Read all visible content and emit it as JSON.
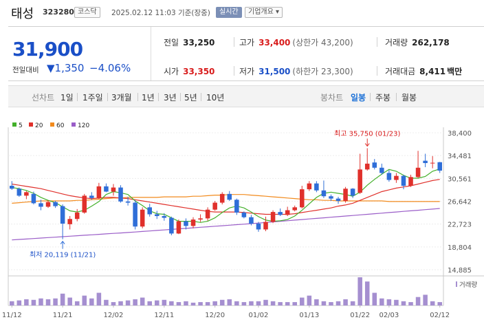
{
  "header": {
    "name": "태성",
    "code": "323280",
    "market": "코스닥",
    "timestamp": "2025.02.12 11:03 기준(장중)",
    "live_label": "실시간",
    "company_label": "기업개요 ▾"
  },
  "quote": {
    "price": "31,900",
    "change_label": "전일대비",
    "change_abs": "▼1,350",
    "change_pct": "−4.06%",
    "prev_close_label": "전일",
    "prev_close": "33,250",
    "high_label": "고가",
    "high": "33,400",
    "upper_limit": "(상한가 43,200)",
    "volume_label": "거래량",
    "volume": "262,178",
    "open_label": "시가",
    "open": "33,350",
    "low_label": "저가",
    "low": "31,500",
    "lower_limit": "(하한가 23,300)",
    "amount_label": "거래대금",
    "amount": "8,411",
    "amount_unit": "백만"
  },
  "periods": {
    "label": "선차트",
    "items": [
      "1일",
      "1주일",
      "3개월",
      "1년",
      "3년",
      "5년",
      "10년"
    ],
    "candle_label": "봉차트",
    "candle_items": [
      "일봉",
      "주봉",
      "월봉"
    ],
    "candle_active": "일봉"
  },
  "colors": {
    "up": "#e0302b",
    "down": "#2f6ed8",
    "ma5": "#43b02a",
    "ma20": "#e0302b",
    "ma60": "#f28a1c",
    "ma120": "#9a5dc8",
    "volume": "#a58fd0",
    "price_blue": "#1a4fc7"
  },
  "chart_data": {
    "type": "candlestick",
    "legend": [
      {
        "name": "5",
        "color": "#43b02a"
      },
      {
        "name": "20",
        "color": "#e0302b"
      },
      {
        "name": "60",
        "color": "#f28a1c"
      },
      {
        "name": "120",
        "color": "#9a5dc8"
      }
    ],
    "y_ticks": [
      "38,400",
      "34,481",
      "30,561",
      "26,642",
      "22,723",
      "18,804",
      "14,885"
    ],
    "ylim": [
      14885,
      38400
    ],
    "x_ticks": [
      "11/12",
      "11/21",
      "12/02",
      "12/11",
      "12/20",
      "01/02",
      "01/13",
      "01/22",
      "02/03",
      "02/12"
    ],
    "high_annotation": "최고 35,750 (01/23)",
    "low_annotation": "최저 20,119 (11/21)",
    "volume_label": "거래량",
    "candles": [
      {
        "d": "11/12",
        "o": 29300,
        "h": 30100,
        "l": 28600,
        "c": 28800
      },
      {
        "d": "11/13",
        "o": 28800,
        "h": 29000,
        "l": 27400,
        "c": 27600
      },
      {
        "d": "11/14",
        "o": 27600,
        "h": 28400,
        "l": 27000,
        "c": 28200
      },
      {
        "d": "11/15",
        "o": 27900,
        "h": 28300,
        "l": 26100,
        "c": 26300
      },
      {
        "d": "11/18",
        "o": 26300,
        "h": 26900,
        "l": 25100,
        "c": 25700
      },
      {
        "d": "11/19",
        "o": 25700,
        "h": 26800,
        "l": 25500,
        "c": 26500
      },
      {
        "d": "11/20",
        "o": 26500,
        "h": 26700,
        "l": 25500,
        "c": 25800
      },
      {
        "d": "11/21",
        "o": 25800,
        "h": 26100,
        "l": 20119,
        "c": 22800
      },
      {
        "d": "11/22",
        "o": 22700,
        "h": 24100,
        "l": 21800,
        "c": 23600
      },
      {
        "d": "11/25",
        "o": 23600,
        "h": 25300,
        "l": 23200,
        "c": 24700
      },
      {
        "d": "11/26",
        "o": 24700,
        "h": 27900,
        "l": 24500,
        "c": 27600
      },
      {
        "d": "11/27",
        "o": 27600,
        "h": 28200,
        "l": 26900,
        "c": 27200
      },
      {
        "d": "11/28",
        "o": 27200,
        "h": 29800,
        "l": 27000,
        "c": 29200
      },
      {
        "d": "11/29",
        "o": 29200,
        "h": 29700,
        "l": 28200,
        "c": 28300
      },
      {
        "d": "12/02",
        "o": 28300,
        "h": 29600,
        "l": 27600,
        "c": 29000
      },
      {
        "d": "12/03",
        "o": 29000,
        "h": 29400,
        "l": 26400,
        "c": 26600
      },
      {
        "d": "12/04",
        "o": 26600,
        "h": 27400,
        "l": 25900,
        "c": 26400
      },
      {
        "d": "12/05",
        "o": 26400,
        "h": 26800,
        "l": 21800,
        "c": 22300
      },
      {
        "d": "12/06",
        "o": 22300,
        "h": 25600,
        "l": 22000,
        "c": 25200
      },
      {
        "d": "12/09",
        "o": 25600,
        "h": 26200,
        "l": 24000,
        "c": 24400
      },
      {
        "d": "12/10",
        "o": 24400,
        "h": 25000,
        "l": 23600,
        "c": 24100
      },
      {
        "d": "12/11",
        "o": 24100,
        "h": 24600,
        "l": 23300,
        "c": 23800
      },
      {
        "d": "12/12",
        "o": 23800,
        "h": 24000,
        "l": 20800,
        "c": 21100
      },
      {
        "d": "12/13",
        "o": 21100,
        "h": 23500,
        "l": 21000,
        "c": 23200
      },
      {
        "d": "12/16",
        "o": 23200,
        "h": 23700,
        "l": 21800,
        "c": 22400
      },
      {
        "d": "12/17",
        "o": 22400,
        "h": 23900,
        "l": 22000,
        "c": 23500
      },
      {
        "d": "12/18",
        "o": 23500,
        "h": 24400,
        "l": 23100,
        "c": 23700
      },
      {
        "d": "12/19",
        "o": 23700,
        "h": 25600,
        "l": 23300,
        "c": 25200
      },
      {
        "d": "12/20",
        "o": 25200,
        "h": 26700,
        "l": 25000,
        "c": 26400
      },
      {
        "d": "12/23",
        "o": 26400,
        "h": 28200,
        "l": 26100,
        "c": 27900
      },
      {
        "d": "12/24",
        "o": 27900,
        "h": 28400,
        "l": 26700,
        "c": 26900
      },
      {
        "d": "12/26",
        "o": 26900,
        "h": 27100,
        "l": 24300,
        "c": 24700
      },
      {
        "d": "12/27",
        "o": 24700,
        "h": 24900,
        "l": 23700,
        "c": 23900
      },
      {
        "d": "12/30",
        "o": 23900,
        "h": 24300,
        "l": 22500,
        "c": 22800
      },
      {
        "d": "01/02",
        "o": 22800,
        "h": 23100,
        "l": 21400,
        "c": 21800
      },
      {
        "d": "01/03",
        "o": 21800,
        "h": 24000,
        "l": 21500,
        "c": 23100
      },
      {
        "d": "01/06",
        "o": 23100,
        "h": 25100,
        "l": 22900,
        "c": 24800
      },
      {
        "d": "01/07",
        "o": 24800,
        "h": 25400,
        "l": 24100,
        "c": 24300
      },
      {
        "d": "01/08",
        "o": 24300,
        "h": 25700,
        "l": 24100,
        "c": 25100
      },
      {
        "d": "01/09",
        "o": 25100,
        "h": 25900,
        "l": 24900,
        "c": 25600
      },
      {
        "d": "01/10",
        "o": 25600,
        "h": 29300,
        "l": 25400,
        "c": 28700
      },
      {
        "d": "01/13",
        "o": 28700,
        "h": 30100,
        "l": 28400,
        "c": 29700
      },
      {
        "d": "01/14",
        "o": 29700,
        "h": 30100,
        "l": 28200,
        "c": 28500
      },
      {
        "d": "01/15",
        "o": 28500,
        "h": 30200,
        "l": 27200,
        "c": 27500
      },
      {
        "d": "01/16",
        "o": 27500,
        "h": 27800,
        "l": 26700,
        "c": 27100
      },
      {
        "d": "01/17",
        "o": 27100,
        "h": 27400,
        "l": 26200,
        "c": 26700
      },
      {
        "d": "01/20",
        "o": 26700,
        "h": 29100,
        "l": 26400,
        "c": 28800
      },
      {
        "d": "01/21",
        "o": 28800,
        "h": 28900,
        "l": 27200,
        "c": 27600
      },
      {
        "d": "01/22",
        "o": 28100,
        "h": 34800,
        "l": 27900,
        "c": 32100
      },
      {
        "d": "01/23",
        "o": 32100,
        "h": 35750,
        "l": 31900,
        "c": 33100
      },
      {
        "d": "01/24",
        "o": 33300,
        "h": 33900,
        "l": 32100,
        "c": 32400
      },
      {
        "d": "01/31",
        "o": 32400,
        "h": 33100,
        "l": 31200,
        "c": 31500
      },
      {
        "d": "02/03",
        "o": 31500,
        "h": 32000,
        "l": 30000,
        "c": 30300
      },
      {
        "d": "02/04",
        "o": 30300,
        "h": 31500,
        "l": 29800,
        "c": 31000
      },
      {
        "d": "02/05",
        "o": 31000,
        "h": 31200,
        "l": 28700,
        "c": 29300
      },
      {
        "d": "02/06",
        "o": 29300,
        "h": 31200,
        "l": 29100,
        "c": 30800
      },
      {
        "d": "02/07",
        "o": 30800,
        "h": 35300,
        "l": 30600,
        "c": 32400
      },
      {
        "d": "02/10",
        "o": 33600,
        "h": 34800,
        "l": 32500,
        "c": 33200
      },
      {
        "d": "02/11",
        "o": 33200,
        "h": 34400,
        "l": 32300,
        "c": 33250
      },
      {
        "d": "02/12",
        "o": 33350,
        "h": 33400,
        "l": 31500,
        "c": 31900
      }
    ],
    "volume_relative": [
      0.15,
      0.18,
      0.22,
      0.2,
      0.25,
      0.22,
      0.25,
      0.42,
      0.28,
      0.15,
      0.35,
      0.25,
      0.45,
      0.2,
      0.12,
      0.15,
      0.18,
      0.22,
      0.28,
      0.15,
      0.18,
      0.2,
      0.15,
      0.12,
      0.15,
      0.1,
      0.12,
      0.12,
      0.15,
      0.2,
      0.22,
      0.15,
      0.12,
      0.15,
      0.15,
      0.2,
      0.15,
      0.12,
      0.12,
      0.12,
      0.28,
      0.35,
      0.22,
      0.15,
      0.12,
      0.15,
      0.22,
      0.15,
      1.0,
      0.85,
      0.45,
      0.25,
      0.22,
      0.2,
      0.15,
      0.12,
      0.3,
      0.38,
      0.15,
      0.12
    ],
    "ma5": [
      29000,
      28800,
      28500,
      28000,
      27300,
      26800,
      26400,
      25700,
      25000,
      24800,
      25100,
      25800,
      26600,
      27800,
      28300,
      28100,
      27800,
      26700,
      25900,
      25000,
      24500,
      24400,
      23800,
      23200,
      23200,
      23200,
      23000,
      23200,
      23800,
      24700,
      25500,
      25800,
      25500,
      24800,
      24000,
      23400,
      23200,
      23300,
      23500,
      24100,
      25100,
      26200,
      27300,
      28000,
      28200,
      28000,
      27800,
      27500,
      28200,
      29400,
      30400,
      31300,
      32100,
      31800,
      31100,
      30600,
      30600,
      30900,
      31800,
      32200
    ],
    "ma20": [
      29600,
      29400,
      29200,
      29000,
      28800,
      28500,
      28200,
      27900,
      27600,
      27400,
      27200,
      27100,
      27200,
      27300,
      27300,
      27200,
      27100,
      26900,
      26700,
      26500,
      26300,
      26100,
      25900,
      25700,
      25500,
      25300,
      25100,
      24900,
      24800,
      24800,
      24800,
      24800,
      24700,
      24600,
      24500,
      24400,
      24400,
      24400,
      24400,
      24500,
      24700,
      24900,
      25100,
      25300,
      25500,
      25800,
      26000,
      26300,
      26800,
      27300,
      27800,
      28300,
      28600,
      28900,
      29100,
      29300,
      29600,
      29900,
      30200,
      30400
    ],
    "ma60": [
      26300,
      26400,
      26500,
      26600,
      26700,
      26700,
      26700,
      26700,
      26700,
      26800,
      26800,
      26900,
      27000,
      27100,
      27200,
      27200,
      27300,
      27300,
      27300,
      27300,
      27300,
      27400,
      27400,
      27400,
      27400,
      27500,
      27500,
      27600,
      27700,
      27700,
      27800,
      27800,
      27800,
      27700,
      27600,
      27500,
      27400,
      27300,
      27200,
      27100,
      27000,
      26900,
      26900,
      26800,
      26800,
      26700,
      26700,
      26700,
      26700,
      26700,
      26700,
      26700,
      26600,
      26600,
      26600,
      26600,
      26600,
      26600,
      26600,
      26600
    ],
    "ma120": [
      20000,
      20080,
      20160,
      20240,
      20320,
      20400,
      20480,
      20560,
      20640,
      20720,
      20800,
      20880,
      20960,
      21040,
      21120,
      21200,
      21280,
      21360,
      21450,
      21540,
      21630,
      21720,
      21810,
      21900,
      21990,
      22080,
      22170,
      22260,
      22350,
      22440,
      22530,
      22620,
      22710,
      22800,
      22900,
      23000,
      23100,
      23200,
      23300,
      23400,
      23500,
      23600,
      23700,
      23800,
      23900,
      24000,
      24100,
      24200,
      24300,
      24400,
      24500,
      24600,
      24700,
      24800,
      24900,
      25000,
      25100,
      25200,
      25300,
      25400
    ]
  }
}
